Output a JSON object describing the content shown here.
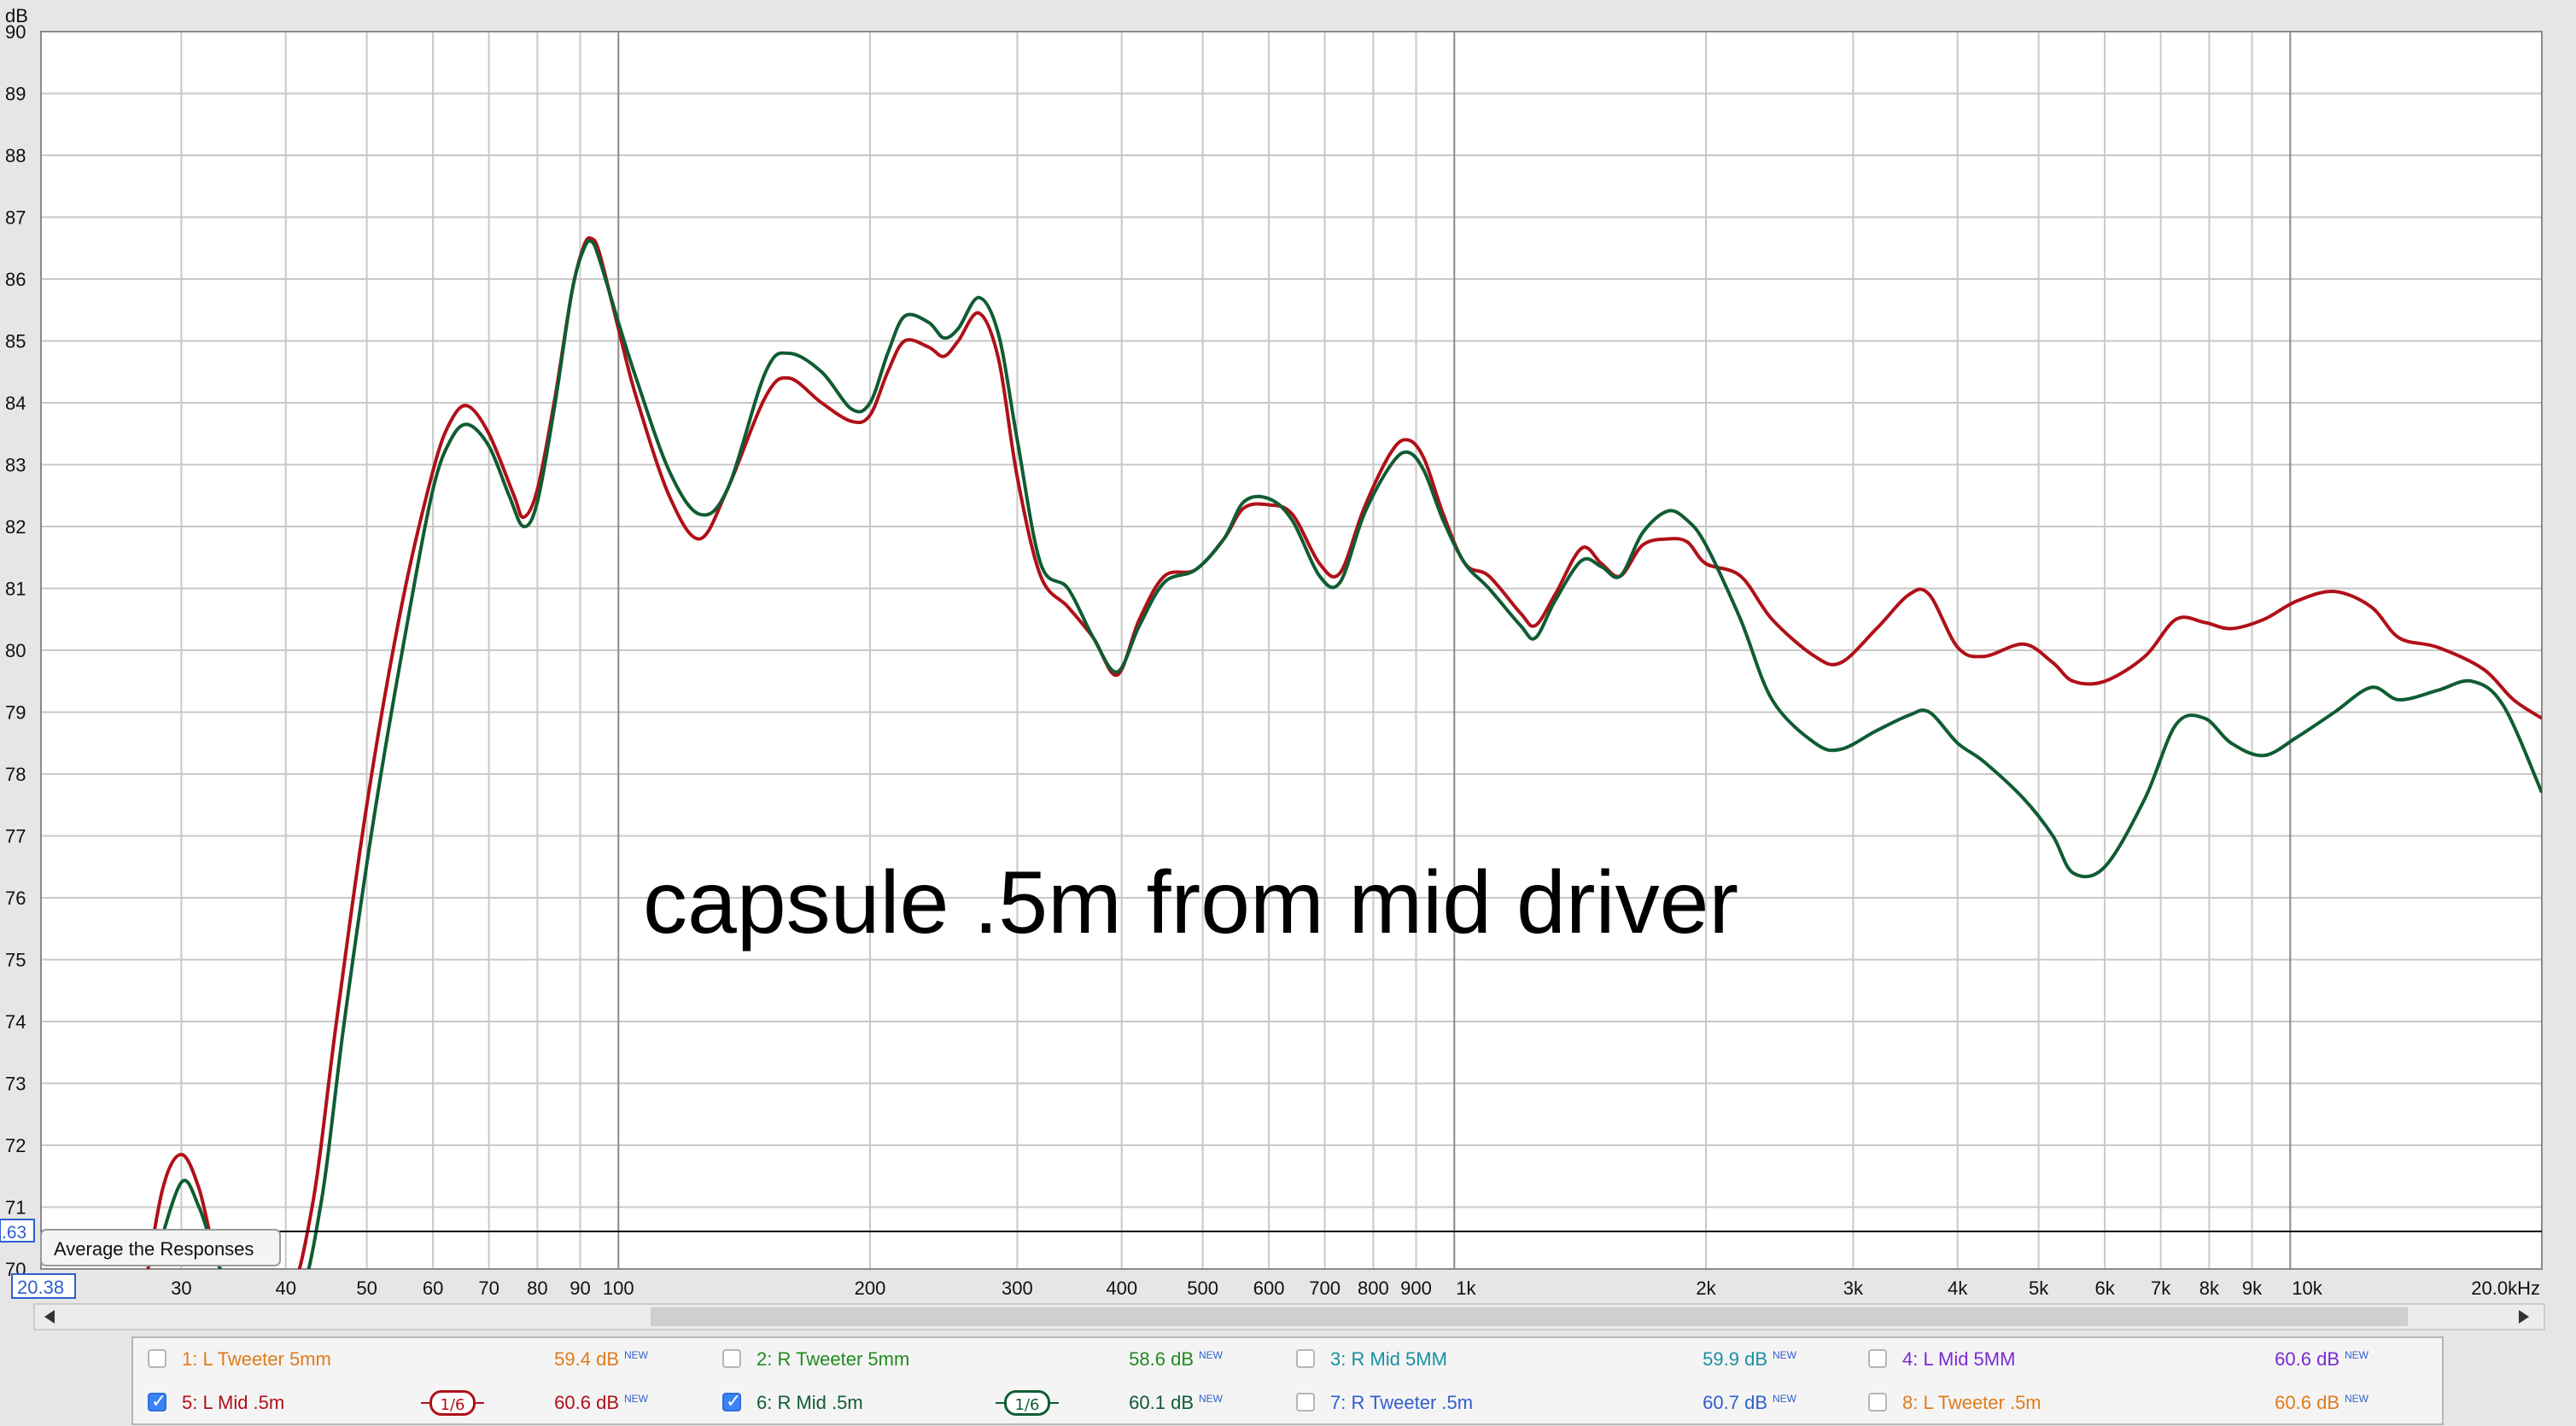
{
  "chart_data": {
    "type": "line",
    "title": "capsule .5m from mid driver",
    "ylabel": "dB",
    "x_scale": "log",
    "xlim": [
      20.38,
      20000
    ],
    "ylim": [
      70,
      90
    ],
    "x_ticks": [
      {
        "v": 30,
        "label": "30"
      },
      {
        "v": 40,
        "label": "40"
      },
      {
        "v": 50,
        "label": "50"
      },
      {
        "v": 60,
        "label": "60"
      },
      {
        "v": 70,
        "label": "70"
      },
      {
        "v": 80,
        "label": "80"
      },
      {
        "v": 90,
        "label": "90"
      },
      {
        "v": 100,
        "label": "100"
      },
      {
        "v": 200,
        "label": "200"
      },
      {
        "v": 300,
        "label": "300"
      },
      {
        "v": 400,
        "label": "400"
      },
      {
        "v": 500,
        "label": "500"
      },
      {
        "v": 600,
        "label": "600"
      },
      {
        "v": 700,
        "label": "700"
      },
      {
        "v": 800,
        "label": "800"
      },
      {
        "v": 900,
        "label": "900"
      },
      {
        "v": 1000,
        "label": "1k"
      },
      {
        "v": 2000,
        "label": "2k"
      },
      {
        "v": 3000,
        "label": "3k"
      },
      {
        "v": 4000,
        "label": "4k"
      },
      {
        "v": 5000,
        "label": "5k"
      },
      {
        "v": 6000,
        "label": "6k"
      },
      {
        "v": 7000,
        "label": "7k"
      },
      {
        "v": 8000,
        "label": "8k"
      },
      {
        "v": 9000,
        "label": "9k"
      },
      {
        "v": 10000,
        "label": "10k"
      },
      {
        "v": 20000,
        "label": "20.0kHz"
      }
    ],
    "y_ticks": [
      "70",
      "71",
      "72",
      "73",
      "74",
      "75",
      "76",
      "77",
      "78",
      "79",
      "80",
      "81",
      "82",
      "83",
      "84",
      "85",
      "86",
      "87",
      "88",
      "89",
      "90"
    ],
    "x_min_label": "20.38",
    "y_marker_label": ".63",
    "y_marker_value": 70.63,
    "grid": true,
    "series": [
      {
        "name": "5: L Mid .5m",
        "color": "#b01018",
        "points": [
          [
            27,
            69.5
          ],
          [
            28.5,
            71.3
          ],
          [
            30,
            71.85
          ],
          [
            31.5,
            71.3
          ],
          [
            33,
            70.2
          ],
          [
            35,
            69.5
          ],
          [
            40,
            69.5
          ],
          [
            43,
            71
          ],
          [
            46,
            74
          ],
          [
            50,
            77.5
          ],
          [
            55,
            80.7
          ],
          [
            60,
            82.9
          ],
          [
            63,
            83.7
          ],
          [
            66,
            83.95
          ],
          [
            70,
            83.5
          ],
          [
            75,
            82.5
          ],
          [
            77,
            82.15
          ],
          [
            80,
            82.6
          ],
          [
            84,
            84.1
          ],
          [
            88,
            85.8
          ],
          [
            91,
            86.55
          ],
          [
            93,
            86.65
          ],
          [
            95,
            86.4
          ],
          [
            100,
            85.2
          ],
          [
            105,
            84.1
          ],
          [
            115,
            82.5
          ],
          [
            125,
            81.8
          ],
          [
            135,
            82.6
          ],
          [
            150,
            84.1
          ],
          [
            160,
            84.4
          ],
          [
            175,
            84
          ],
          [
            190,
            83.7
          ],
          [
            200,
            83.8
          ],
          [
            210,
            84.5
          ],
          [
            220,
            85
          ],
          [
            235,
            84.9
          ],
          [
            245,
            84.75
          ],
          [
            255,
            85
          ],
          [
            270,
            85.45
          ],
          [
            285,
            84.7
          ],
          [
            300,
            82.8
          ],
          [
            320,
            81.2
          ],
          [
            345,
            80.7
          ],
          [
            370,
            80.2
          ],
          [
            395,
            79.6
          ],
          [
            420,
            80.5
          ],
          [
            450,
            81.2
          ],
          [
            490,
            81.3
          ],
          [
            530,
            81.8
          ],
          [
            560,
            82.3
          ],
          [
            600,
            82.35
          ],
          [
            640,
            82.2
          ],
          [
            690,
            81.4
          ],
          [
            730,
            81.25
          ],
          [
            780,
            82.3
          ],
          [
            840,
            83.2
          ],
          [
            880,
            83.4
          ],
          [
            920,
            83.1
          ],
          [
            970,
            82.2
          ],
          [
            1030,
            81.4
          ],
          [
            1100,
            81.2
          ],
          [
            1200,
            80.6
          ],
          [
            1250,
            80.4
          ],
          [
            1320,
            80.9
          ],
          [
            1420,
            81.65
          ],
          [
            1500,
            81.4
          ],
          [
            1580,
            81.2
          ],
          [
            1680,
            81.7
          ],
          [
            1800,
            81.8
          ],
          [
            1900,
            81.75
          ],
          [
            2000,
            81.4
          ],
          [
            2200,
            81.2
          ],
          [
            2400,
            80.5
          ],
          [
            2700,
            79.9
          ],
          [
            2900,
            79.8
          ],
          [
            3200,
            80.35
          ],
          [
            3500,
            80.9
          ],
          [
            3700,
            80.9
          ],
          [
            4000,
            80.05
          ],
          [
            4300,
            79.9
          ],
          [
            4800,
            80.1
          ],
          [
            5200,
            79.8
          ],
          [
            5500,
            79.5
          ],
          [
            6000,
            79.5
          ],
          [
            6700,
            79.9
          ],
          [
            7300,
            80.5
          ],
          [
            7900,
            80.45
          ],
          [
            8500,
            80.35
          ],
          [
            9300,
            80.5
          ],
          [
            10200,
            80.8
          ],
          [
            11300,
            80.95
          ],
          [
            12500,
            80.7
          ],
          [
            13500,
            80.2
          ],
          [
            15000,
            80.05
          ],
          [
            17000,
            79.7
          ],
          [
            18500,
            79.2
          ],
          [
            20000,
            78.9
          ]
        ]
      },
      {
        "name": "6: R Mid .5m",
        "color": "#0f5c33",
        "points": [
          [
            28,
            70.2
          ],
          [
            30,
            71.4
          ],
          [
            31.5,
            71
          ],
          [
            33,
            70.2
          ],
          [
            35,
            69.5
          ],
          [
            41,
            69.5
          ],
          [
            44,
            71
          ],
          [
            47,
            74
          ],
          [
            51,
            77.3
          ],
          [
            56,
            80.5
          ],
          [
            60,
            82.6
          ],
          [
            63,
            83.4
          ],
          [
            66,
            83.65
          ],
          [
            70,
            83.3
          ],
          [
            74,
            82.5
          ],
          [
            77,
            82
          ],
          [
            80,
            82.4
          ],
          [
            84,
            84
          ],
          [
            88,
            85.8
          ],
          [
            91,
            86.5
          ],
          [
            93,
            86.6
          ],
          [
            95,
            86.3
          ],
          [
            100,
            85.3
          ],
          [
            105,
            84.4
          ],
          [
            115,
            82.9
          ],
          [
            125,
            82.2
          ],
          [
            135,
            82.6
          ],
          [
            150,
            84.5
          ],
          [
            160,
            84.8
          ],
          [
            175,
            84.5
          ],
          [
            190,
            83.9
          ],
          [
            200,
            84
          ],
          [
            210,
            84.8
          ],
          [
            220,
            85.4
          ],
          [
            235,
            85.3
          ],
          [
            245,
            85.05
          ],
          [
            255,
            85.2
          ],
          [
            270,
            85.7
          ],
          [
            285,
            85.1
          ],
          [
            300,
            83.4
          ],
          [
            320,
            81.4
          ],
          [
            345,
            81
          ],
          [
            370,
            80.2
          ],
          [
            395,
            79.65
          ],
          [
            420,
            80.4
          ],
          [
            450,
            81.1
          ],
          [
            490,
            81.3
          ],
          [
            530,
            81.8
          ],
          [
            560,
            82.4
          ],
          [
            600,
            82.45
          ],
          [
            640,
            82.1
          ],
          [
            690,
            81.2
          ],
          [
            730,
            81.1
          ],
          [
            780,
            82.2
          ],
          [
            840,
            83.0
          ],
          [
            880,
            83.2
          ],
          [
            920,
            82.9
          ],
          [
            970,
            82.1
          ],
          [
            1030,
            81.4
          ],
          [
            1100,
            81.0
          ],
          [
            1200,
            80.4
          ],
          [
            1250,
            80.2
          ],
          [
            1320,
            80.8
          ],
          [
            1420,
            81.45
          ],
          [
            1500,
            81.35
          ],
          [
            1580,
            81.2
          ],
          [
            1680,
            81.9
          ],
          [
            1800,
            82.25
          ],
          [
            1900,
            82.1
          ],
          [
            2000,
            81.7
          ],
          [
            2200,
            80.5
          ],
          [
            2400,
            79.2
          ],
          [
            2700,
            78.5
          ],
          [
            2900,
            78.4
          ],
          [
            3200,
            78.7
          ],
          [
            3500,
            78.95
          ],
          [
            3700,
            79.0
          ],
          [
            4000,
            78.5
          ],
          [
            4300,
            78.2
          ],
          [
            4800,
            77.6
          ],
          [
            5200,
            77.0
          ],
          [
            5500,
            76.4
          ],
          [
            6000,
            76.5
          ],
          [
            6700,
            77.6
          ],
          [
            7300,
            78.8
          ],
          [
            7900,
            78.9
          ],
          [
            8500,
            78.5
          ],
          [
            9300,
            78.3
          ],
          [
            10200,
            78.6
          ],
          [
            11300,
            79.0
          ],
          [
            12500,
            79.4
          ],
          [
            13500,
            79.2
          ],
          [
            15000,
            79.35
          ],
          [
            16500,
            79.5
          ],
          [
            18000,
            79.1
          ],
          [
            20000,
            77.7
          ]
        ]
      }
    ]
  },
  "overlay": {
    "label": "capsule .5m from mid driver",
    "average_button": "Average the Responses"
  },
  "legend": [
    {
      "name": "1: L Tweeter 5mm",
      "db": "59.4 dB",
      "new": "NEW",
      "checked": false,
      "color": "#e07b1a"
    },
    {
      "name": "2: R Tweeter 5mm",
      "db": "58.6 dB",
      "new": "NEW",
      "checked": false,
      "color": "#1f8a1f"
    },
    {
      "name": "3: R Mid 5MM",
      "db": "59.9 dB",
      "new": "NEW",
      "checked": false,
      "color": "#1a8fa0"
    },
    {
      "name": "4: L Mid 5MM",
      "db": "60.6 dB",
      "new": "NEW",
      "checked": false,
      "color": "#7a2ad0"
    },
    {
      "name": "5: L Mid .5m",
      "db": "60.6 dB",
      "new": "NEW",
      "checked": true,
      "color": "#b01018",
      "smoothing": "1/6"
    },
    {
      "name": "6: R Mid .5m",
      "db": "60.1 dB",
      "new": "NEW",
      "checked": true,
      "color": "#0f5c33",
      "smoothing": "1/6"
    },
    {
      "name": "7: R Tweeter .5m",
      "db": "60.7 dB",
      "new": "NEW",
      "checked": false,
      "color": "#2f5fcf"
    },
    {
      "name": "8: L Tweeter .5m",
      "db": "60.6 dB",
      "new": "NEW",
      "checked": false,
      "color": "#e07b1a"
    }
  ]
}
